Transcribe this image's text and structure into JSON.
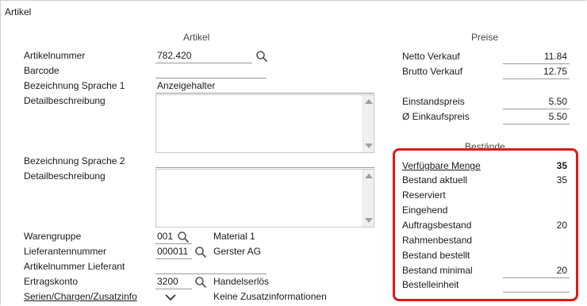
{
  "window": {
    "title": "Artikel"
  },
  "artikel_section": {
    "title": "Artikel",
    "artikelnummer": {
      "label": "Artikelnummer",
      "value": "782.420"
    },
    "barcode": {
      "label": "Barcode",
      "value": ""
    },
    "bezeichnung1": {
      "label": "Bezeichnung Sprache 1",
      "value": "Anzeigehalter"
    },
    "detail1": {
      "label": "Detailbeschreibung",
      "value": ""
    },
    "bezeichnung2": {
      "label": "Bezeichnung Sprache 2",
      "value": ""
    },
    "detail2": {
      "label": "Detailbeschreibung",
      "value": ""
    },
    "warengruppe": {
      "label": "Warengruppe",
      "code": "001",
      "name": "Material 1"
    },
    "lieferantennummer": {
      "label": "Lieferantennummer",
      "code": "000011",
      "name": "Gerster AG"
    },
    "artikelnummer_lieferant": {
      "label": "Artikelnummer Lieferant",
      "value": ""
    },
    "ertragskonto": {
      "label": "Ertragskonto",
      "code": "3200",
      "name": "Handelserlös"
    },
    "serien": {
      "label": "Serien/Chargen/Zusatzinfo",
      "value": "Keine Zusatzinformationen"
    }
  },
  "preise_section": {
    "title": "Preise",
    "netto": {
      "label": "Netto Verkauf",
      "value": "11.84"
    },
    "brutto": {
      "label": "Brutto Verkauf",
      "value": "12.75"
    },
    "einstand": {
      "label": "Einstandspreis",
      "value": "5.50"
    },
    "einkauf": {
      "label": "Ø Einkaufspreis",
      "value": "5.50"
    }
  },
  "bestaende_section": {
    "title": "Bestände",
    "verfuegbar": {
      "label": "Verfügbare Menge",
      "value": "35"
    },
    "aktuell": {
      "label": "Bestand aktuell",
      "value": "35"
    },
    "reserviert": {
      "label": "Reserviert",
      "value": ""
    },
    "eingehend": {
      "label": "Eingehend",
      "value": ""
    },
    "auftrag": {
      "label": "Auftragsbestand",
      "value": "20"
    },
    "rahmen": {
      "label": "Rahmenbestand",
      "value": ""
    },
    "bestellt": {
      "label": "Bestand bestellt",
      "value": ""
    },
    "minimal": {
      "label": "Bestand minimal",
      "value": "20"
    },
    "einheit": {
      "label": "Bestelleinheit",
      "value": ""
    }
  },
  "icons": {
    "search": "search-icon",
    "chevron": "chevron-down-icon",
    "scroll_up": "scroll-up-icon",
    "scroll_down": "scroll-down-icon"
  },
  "colors": {
    "highlight_border": "#e01818",
    "underline": "#9a9a9a"
  }
}
